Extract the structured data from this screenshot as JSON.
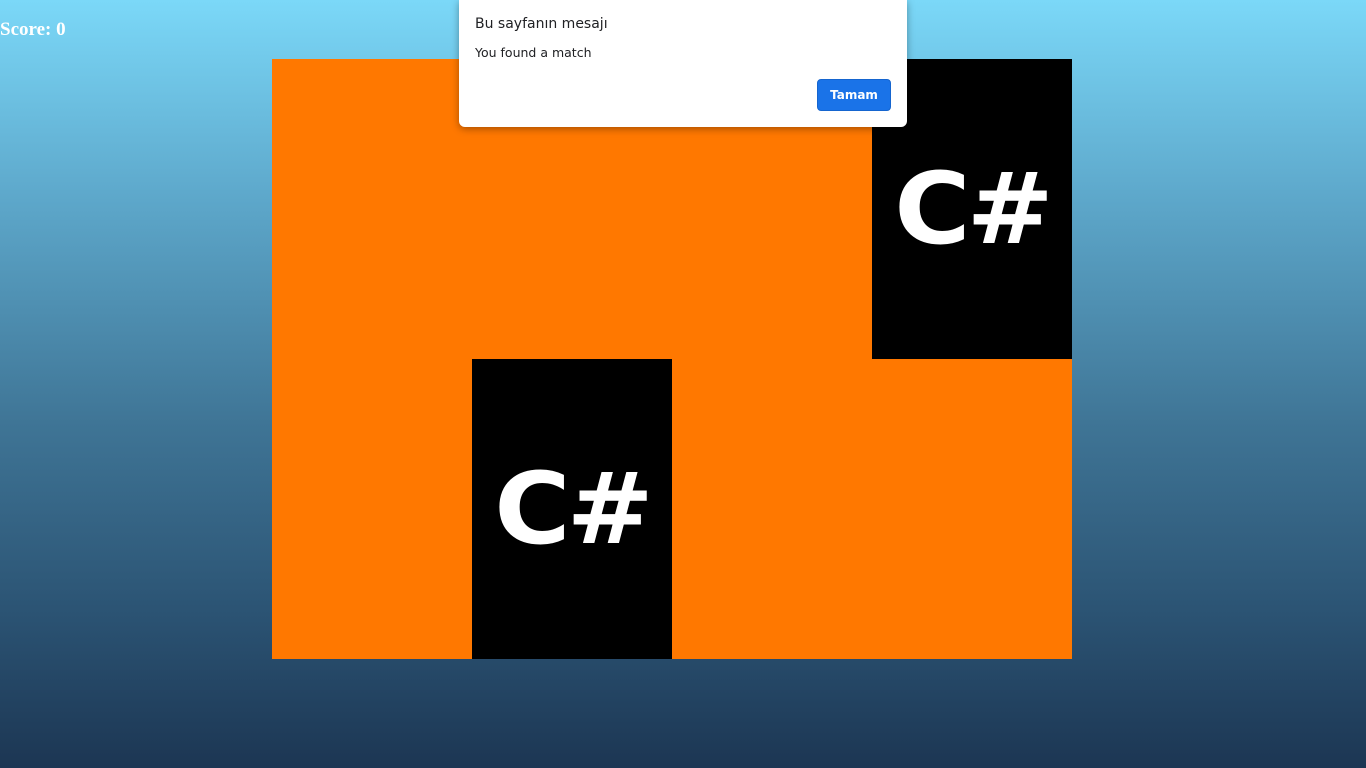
{
  "hud": {
    "score_text": "Score: 0"
  },
  "board": {
    "columns": 4,
    "rows": 2,
    "back_color": "#ff7800",
    "face_color": "#000000",
    "cards": [
      {
        "state": "hidden"
      },
      {
        "state": "hidden"
      },
      {
        "state": "hidden"
      },
      {
        "state": "revealed",
        "logo": "C#"
      },
      {
        "state": "hidden"
      },
      {
        "state": "revealed",
        "logo": "C#"
      },
      {
        "state": "hidden"
      },
      {
        "state": "hidden"
      }
    ]
  },
  "dialog": {
    "title": "Bu sayfanın mesajı",
    "message": "You found a match",
    "ok_label": "Tamam",
    "button_color": "#1a73e8"
  }
}
